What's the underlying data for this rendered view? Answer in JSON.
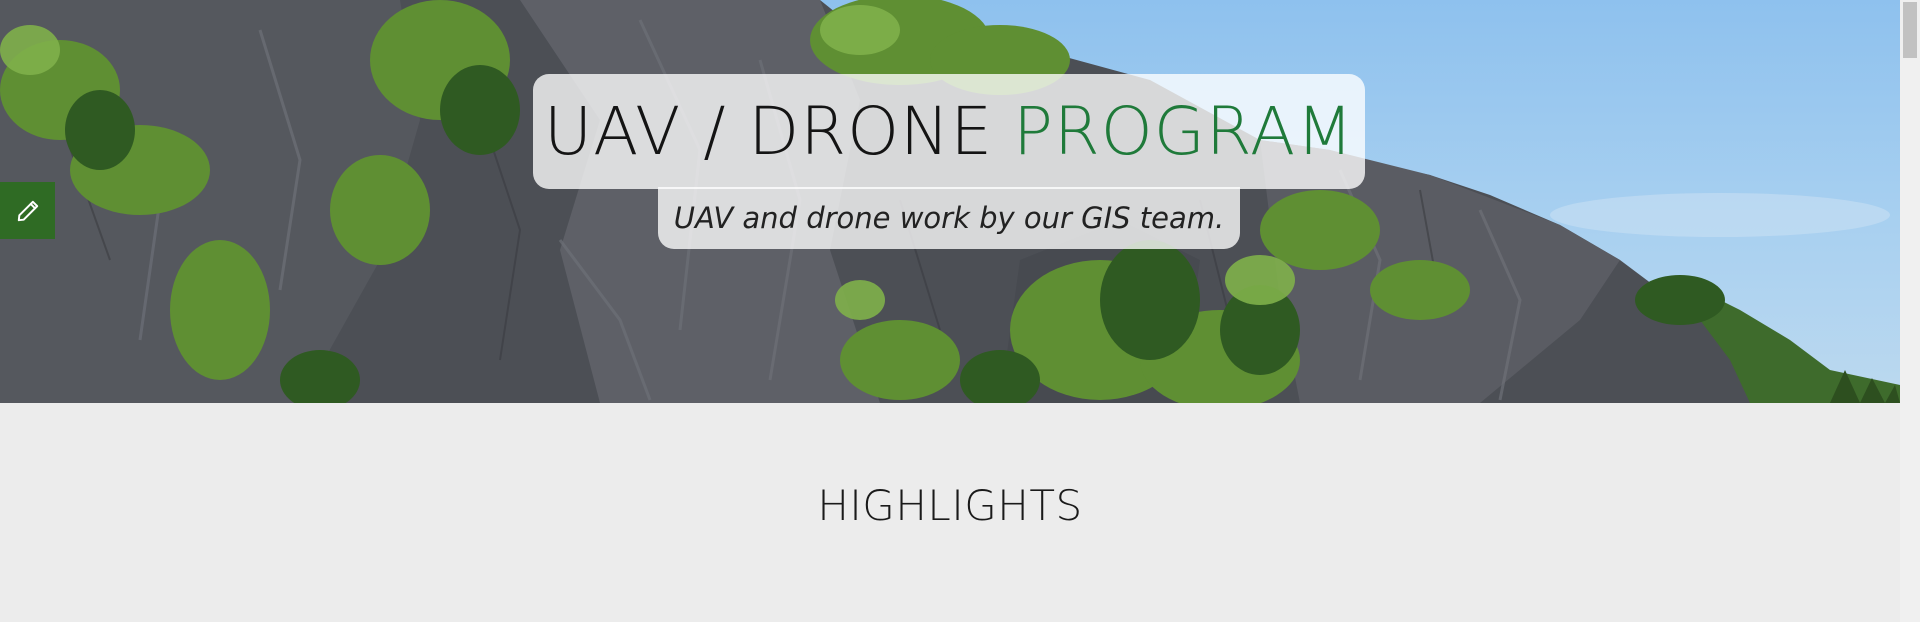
{
  "hero": {
    "title_main": "UAV / DRONE",
    "title_accent": "PROGRAM",
    "subtitle": "UAV and drone work by our GIS team."
  },
  "edit_button": {
    "icon": "pencil-icon"
  },
  "section": {
    "title": "HIGHLIGHTS"
  },
  "colors": {
    "accent_green": "#1f7a3a",
    "edit_button_bg": "#2f6b24",
    "section_bg": "#ececec"
  }
}
